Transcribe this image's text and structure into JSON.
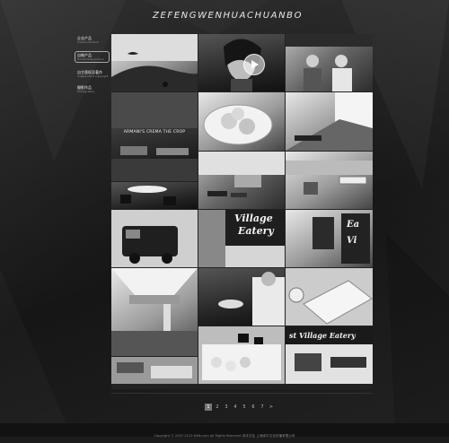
{
  "brand": {
    "logo_text": "ZEFENGWENHUACHUANBO"
  },
  "nav": {
    "items": [
      {
        "zh": "企业产品",
        "en": "Custom Product",
        "active": false
      },
      {
        "zh": "自制产品",
        "en": "Homemade product",
        "active": true
      },
      {
        "zh": "自主版权及著作",
        "en": "independent copyright",
        "active": false
      },
      {
        "zh": "摄影作品",
        "en": "Photography",
        "active": false
      }
    ]
  },
  "gallery": {
    "tiles": [
      {
        "name": "tile-beach",
        "caption": ""
      },
      {
        "name": "tile-portrait-video",
        "caption": ""
      },
      {
        "name": "tile-shop-owners",
        "caption": ""
      },
      {
        "name": "tile-armani",
        "caption": "ARMANI'S CREMA THE CROP"
      },
      {
        "name": "tile-dumplings",
        "caption": ""
      },
      {
        "name": "tile-interior-window",
        "caption": ""
      },
      {
        "name": "tile-lounge",
        "caption": ""
      },
      {
        "name": "tile-office",
        "caption": ""
      },
      {
        "name": "tile-cafe-chairs",
        "caption": ""
      },
      {
        "name": "tile-van",
        "caption": ""
      },
      {
        "name": "tile-village-eatery-sign",
        "caption": ""
      },
      {
        "name": "tile-eatery-cups",
        "caption": ""
      },
      {
        "name": "tile-mall-atrium",
        "caption": ""
      },
      {
        "name": "tile-chef-plating",
        "caption": ""
      },
      {
        "name": "tile-plates-platter",
        "caption": ""
      },
      {
        "name": "tile-dessert-tray",
        "caption": ""
      },
      {
        "name": "tile-eatery-storefront",
        "caption": ""
      },
      {
        "name": "tile-food-court",
        "caption": ""
      }
    ],
    "signs": {
      "village": "Village",
      "eatery": "Eatery",
      "storefront": "st Village Eatery",
      "cup_ea": "Ea",
      "cup_vi": "Vi"
    }
  },
  "pager": {
    "pages": [
      "1",
      "2",
      "3",
      "4",
      "5",
      "6",
      "7",
      ">"
    ],
    "current": "1"
  },
  "footer": {
    "copyright": "Copyright © 2007-2013 ttlife.com All Rights Reserved 泽丰文化 上海泽丰文化传播有限公司"
  }
}
